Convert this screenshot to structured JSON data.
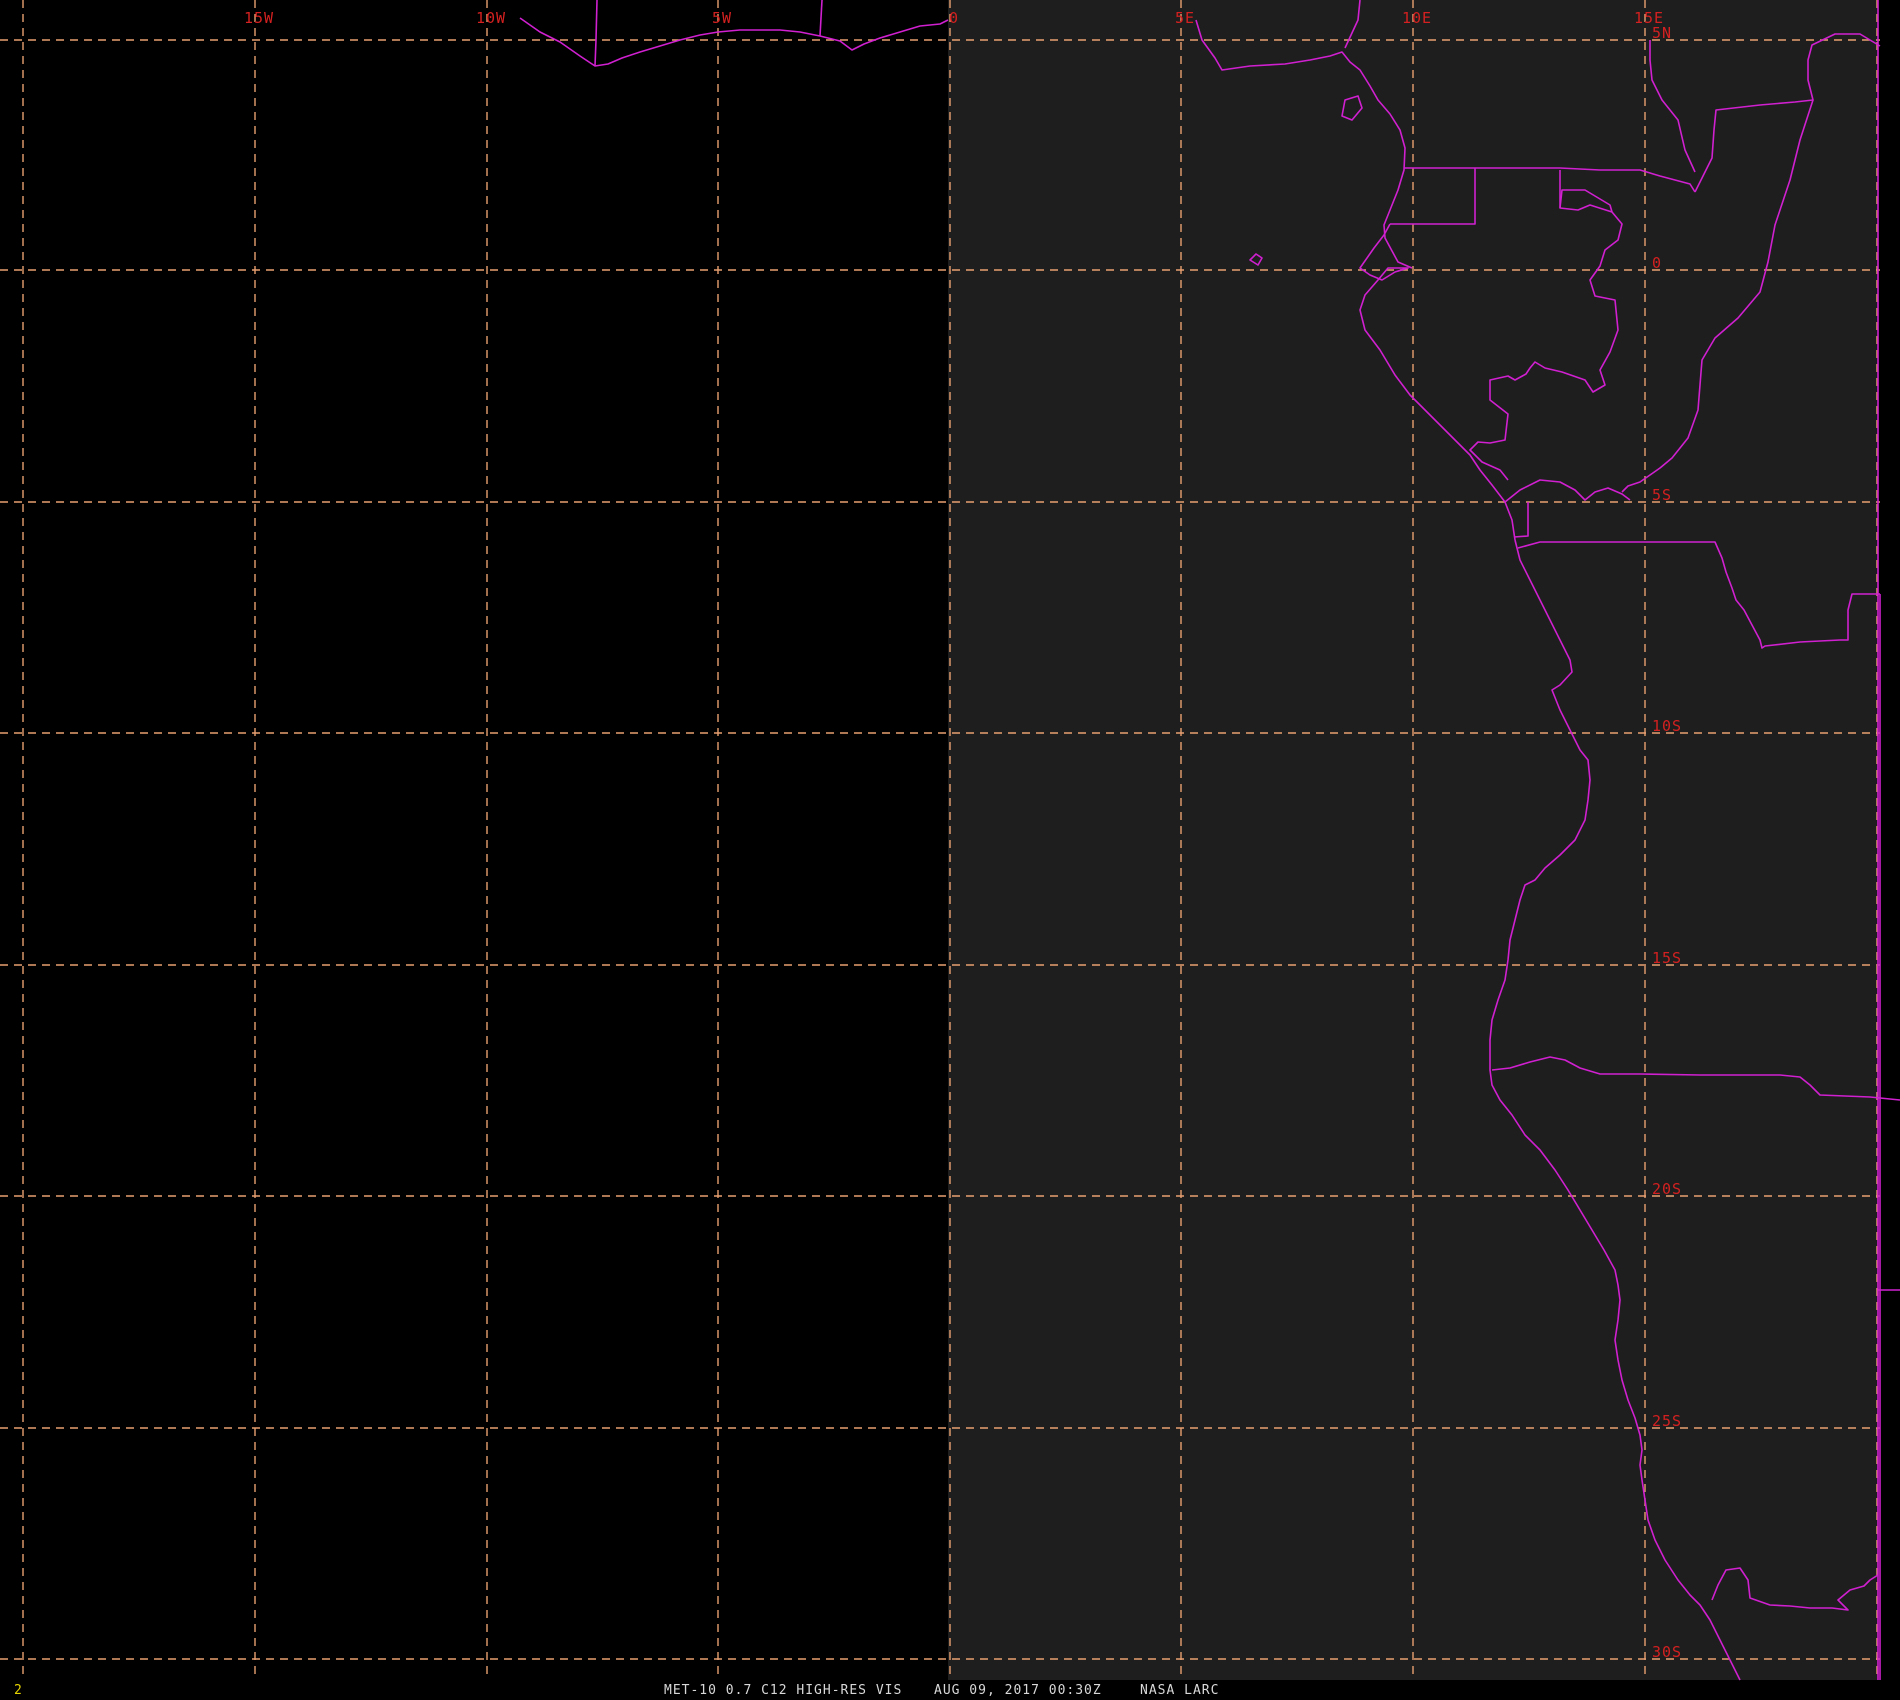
{
  "map": {
    "longitude_labels": [
      "15W",
      "10W",
      "5W",
      "0",
      "5E",
      "10E",
      "15E"
    ],
    "latitude_labels": [
      "5N",
      "0",
      "5S",
      "10S",
      "15S",
      "20S",
      "25S",
      "30S"
    ],
    "colors": {
      "background_west": "#000000",
      "background_east": "#1e1e1e",
      "grid": "#e8a070",
      "borders": "#d020d0",
      "labels": "#d42020"
    }
  },
  "footer": {
    "frame_number": "2",
    "satellite": "MET-10 0.7 C12 HIGH-RES VIS",
    "datetime": "AUG 09, 2017 00:30Z",
    "source": "NASA LARC"
  }
}
